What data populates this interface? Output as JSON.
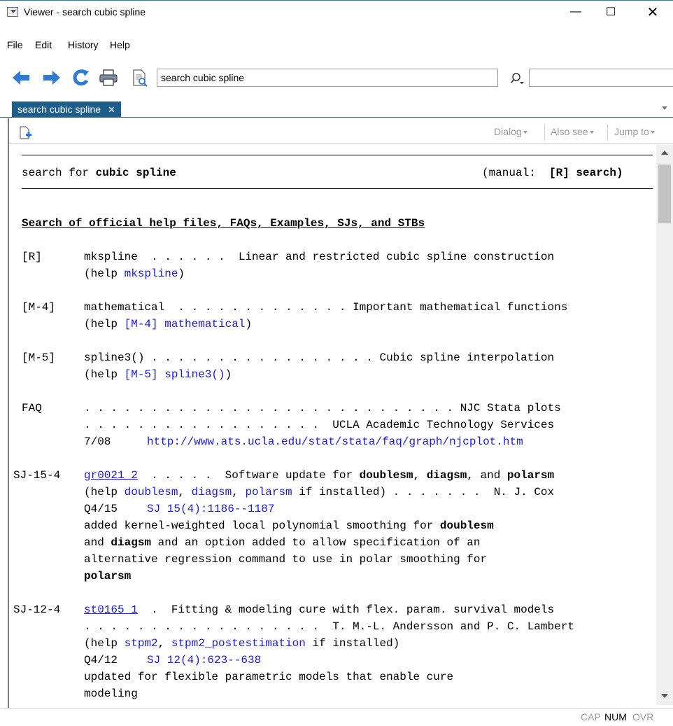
{
  "window": {
    "title": "Viewer - search cubic spline",
    "minimize": "—",
    "maximize": "☐",
    "close": "✕"
  },
  "menu": [
    "File",
    "Edit",
    "History",
    "Help"
  ],
  "toolbar": {
    "search_value": "search cubic spline",
    "find_value": ""
  },
  "tab": {
    "label": "search cubic spline",
    "close": "✕"
  },
  "viewer_toolbar": {
    "dialog": "Dialog",
    "also_see": "Also see",
    "jump_to": "Jump to"
  },
  "doc": {
    "header_left": "search for",
    "header_term": "cubic spline",
    "header_manual": "(manual:",
    "header_ref": "[R] search)",
    "section_title": "Search of official help files, FAQs, Examples, SJs, and STBs",
    "entries": {
      "mkspline": {
        "tag": "[R]",
        "line1": "mkspline  . . . . . .  Linear and restricted cubic spline construction",
        "help_prefix": "(help ",
        "help_link": "mkspline",
        "help_suffix": ")"
      },
      "mathematical": {
        "tag": "[M-4]",
        "line1": "mathematical  . . . . . . . . . . . . . Important mathematical functions",
        "help_prefix": "(help ",
        "help_link": "[M-4] mathematical",
        "help_suffix": ")"
      },
      "spline3": {
        "tag": "[M-5]",
        "line1": "spline3() . . . . . . . . . . . . . . . . . Cubic spline interpolation",
        "help_prefix": "(help ",
        "help_link": "[M-5] spline3()",
        "help_suffix": ")"
      },
      "faq": {
        "tag": "FAQ",
        "line1": ". . . . . . . . . . . . . . . . . . . . . . . . . . . . NJC Stata plots",
        "line2": ". . . . . . . . . . . . . . . . . .  UCLA Academic Technology Services",
        "date": "7/08",
        "url": "http://www.ats.ucla.edu/stat/stata/faq/graph/njcplot.htm"
      },
      "sj15": {
        "tag": "SJ-15-4",
        "link": "gr0021_2",
        "line1_rest": "  . . . . .  Software update for ",
        "b1": "doublesm",
        "t1": ", ",
        "b2": "diagsm",
        "t2": ", and ",
        "b3": "polarsm",
        "help_prefix": "(help ",
        "h1": "doublesm",
        "hs1": ", ",
        "h2": "diagsm",
        "hs2": ", ",
        "h3": "polarsm",
        "help_suffix": " if installed) . . . . . . .  N. J. Cox",
        "date": "Q4/15",
        "cite": "SJ 15(4):1186--1187",
        "desc1_pre": "added kernel-weighted local polynomial smoothing for ",
        "desc1_b": "doublesm",
        "desc2_pre": "and ",
        "desc2_b": "diagsm",
        "desc2_post": " and an option added to allow specification of an",
        "desc3": "alternative regression command to use in polar smoothing for",
        "desc4_b": "polarsm"
      },
      "sj12": {
        "tag": "SJ-12-4",
        "link": "st0165_1",
        "line1_rest": "  .  Fitting & modeling cure with flex. param. survival models",
        "line2": ". . . . . . . . . . . . . . . . . .  T. M.-L. Andersson and P. C. Lambert",
        "help_prefix": "(help ",
        "h1": "stpm2",
        "hs1": ", ",
        "h2": "stpm2_postestimation",
        "help_suffix": " if installed)",
        "date": "Q4/12",
        "cite": "SJ 12(4):623--638",
        "desc1": "updated for flexible parametric models that enable cure",
        "desc2": "modeling"
      }
    }
  },
  "status": {
    "cap": "CAP",
    "num": "NUM",
    "ovr": "OVR"
  },
  "colors": {
    "tab_bg": "#1f5d8b",
    "link": "#1a1ae6",
    "toolbar_arrow": "#2f7ad6",
    "title_border": "#2b78c5"
  }
}
